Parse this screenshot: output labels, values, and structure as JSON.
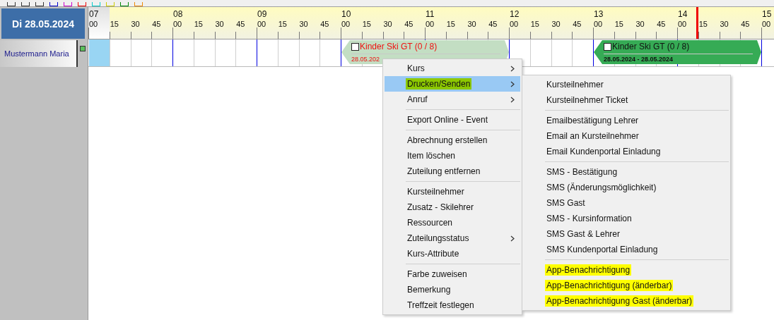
{
  "date_header": {
    "label": "Di 28.05.2024"
  },
  "resources": [
    {
      "name": "Mustermann Maria",
      "selected": true
    }
  ],
  "timeline": {
    "hours": [
      {
        "label": "07",
        "quarters": [
          "00",
          "15",
          "30",
          "45"
        ]
      },
      {
        "label": "08",
        "quarters": [
          "00",
          "15",
          "30",
          "45"
        ]
      },
      {
        "label": "09",
        "quarters": [
          "00",
          "15",
          "30",
          "45"
        ]
      },
      {
        "label": "10",
        "quarters": [
          "00",
          "15",
          "30",
          "45"
        ]
      },
      {
        "label": "11",
        "quarters": [
          "00",
          "15",
          "30",
          "45"
        ]
      },
      {
        "label": "12",
        "quarters": [
          "00",
          "15",
          "30",
          "45"
        ]
      },
      {
        "label": "13",
        "quarters": [
          "00",
          "15",
          "30",
          "45"
        ]
      },
      {
        "label": "14",
        "quarters": [
          "00",
          "15",
          "30",
          "45"
        ]
      },
      {
        "label": "15",
        "quarters": [
          "00"
        ]
      }
    ]
  },
  "events": [
    {
      "title": "Kinder Ski GT (0 / 8)",
      "dates": "28.05.202",
      "checked": false,
      "selected": true
    },
    {
      "title": "Kinder Ski GT (0 / 8)",
      "dates": "28.05.2024 - 28.05.2024",
      "checked": false,
      "selected": false
    }
  ],
  "context_menu": {
    "items": [
      {
        "kind": "item",
        "label": "Kurs",
        "submenu": true,
        "selected": false
      },
      {
        "kind": "item",
        "label": "Drucken/Senden",
        "submenu": true,
        "selected": true,
        "color": "#8cc800"
      },
      {
        "kind": "item",
        "label": "Anruf",
        "submenu": true,
        "selected": false
      },
      {
        "kind": "separator"
      },
      {
        "kind": "item",
        "label": "Export Online - Event",
        "submenu": false,
        "selected": false
      },
      {
        "kind": "separator"
      },
      {
        "kind": "item",
        "label": "Abrechnung erstellen",
        "submenu": false,
        "selected": false
      },
      {
        "kind": "item",
        "label": "Item löschen",
        "submenu": false,
        "selected": false
      },
      {
        "kind": "item",
        "label": "Zuteilung entfernen",
        "submenu": false,
        "selected": false
      },
      {
        "kind": "separator"
      },
      {
        "kind": "item",
        "label": "Kursteilnehmer",
        "submenu": false,
        "selected": false
      },
      {
        "kind": "item",
        "label": "Zusatz - Skilehrer",
        "submenu": false,
        "selected": false
      },
      {
        "kind": "item",
        "label": "Ressourcen",
        "submenu": false,
        "selected": false
      },
      {
        "kind": "item",
        "label": "Zuteilungsstatus",
        "submenu": true,
        "selected": false
      },
      {
        "kind": "item",
        "label": "Kurs-Attribute",
        "submenu": false,
        "selected": false
      },
      {
        "kind": "separator"
      },
      {
        "kind": "item",
        "label": "Farbe zuweisen",
        "submenu": false,
        "selected": false
      },
      {
        "kind": "item",
        "label": "Bemerkung",
        "submenu": false,
        "selected": false
      },
      {
        "kind": "item",
        "label": "Treffzeit festlegen",
        "submenu": false,
        "selected": false
      }
    ]
  },
  "submenu": {
    "items": [
      {
        "kind": "item",
        "label": "Kursteilnehmer"
      },
      {
        "kind": "item",
        "label": "Kursteilnehmer Ticket"
      },
      {
        "kind": "separator"
      },
      {
        "kind": "item",
        "label": "Emailbestätigung Lehrer"
      },
      {
        "kind": "item",
        "label": "Email an Kursteilnehmer"
      },
      {
        "kind": "item",
        "label": "Email Kundenportal Einladung"
      },
      {
        "kind": "separator"
      },
      {
        "kind": "item",
        "label": "SMS - Bestätigung"
      },
      {
        "kind": "item",
        "label": "SMS (Änderungsmöglichkeit)"
      },
      {
        "kind": "item",
        "label": "SMS Gast"
      },
      {
        "kind": "item",
        "label": "SMS - Kursinformation"
      },
      {
        "kind": "item",
        "label": "SMS Gast & Lehrer"
      },
      {
        "kind": "item",
        "label": "SMS Kundenportal Einladung"
      },
      {
        "kind": "separator"
      },
      {
        "kind": "item",
        "label": "App-Benachrichtigung",
        "color": "#ffff00"
      },
      {
        "kind": "item",
        "label": "App-Benachrichtigung (änderbar)",
        "color": "#ffff00"
      },
      {
        "kind": "item",
        "label": "App-Benachrichtigung Gast (änderbar)",
        "color": "#ffff00"
      }
    ]
  }
}
